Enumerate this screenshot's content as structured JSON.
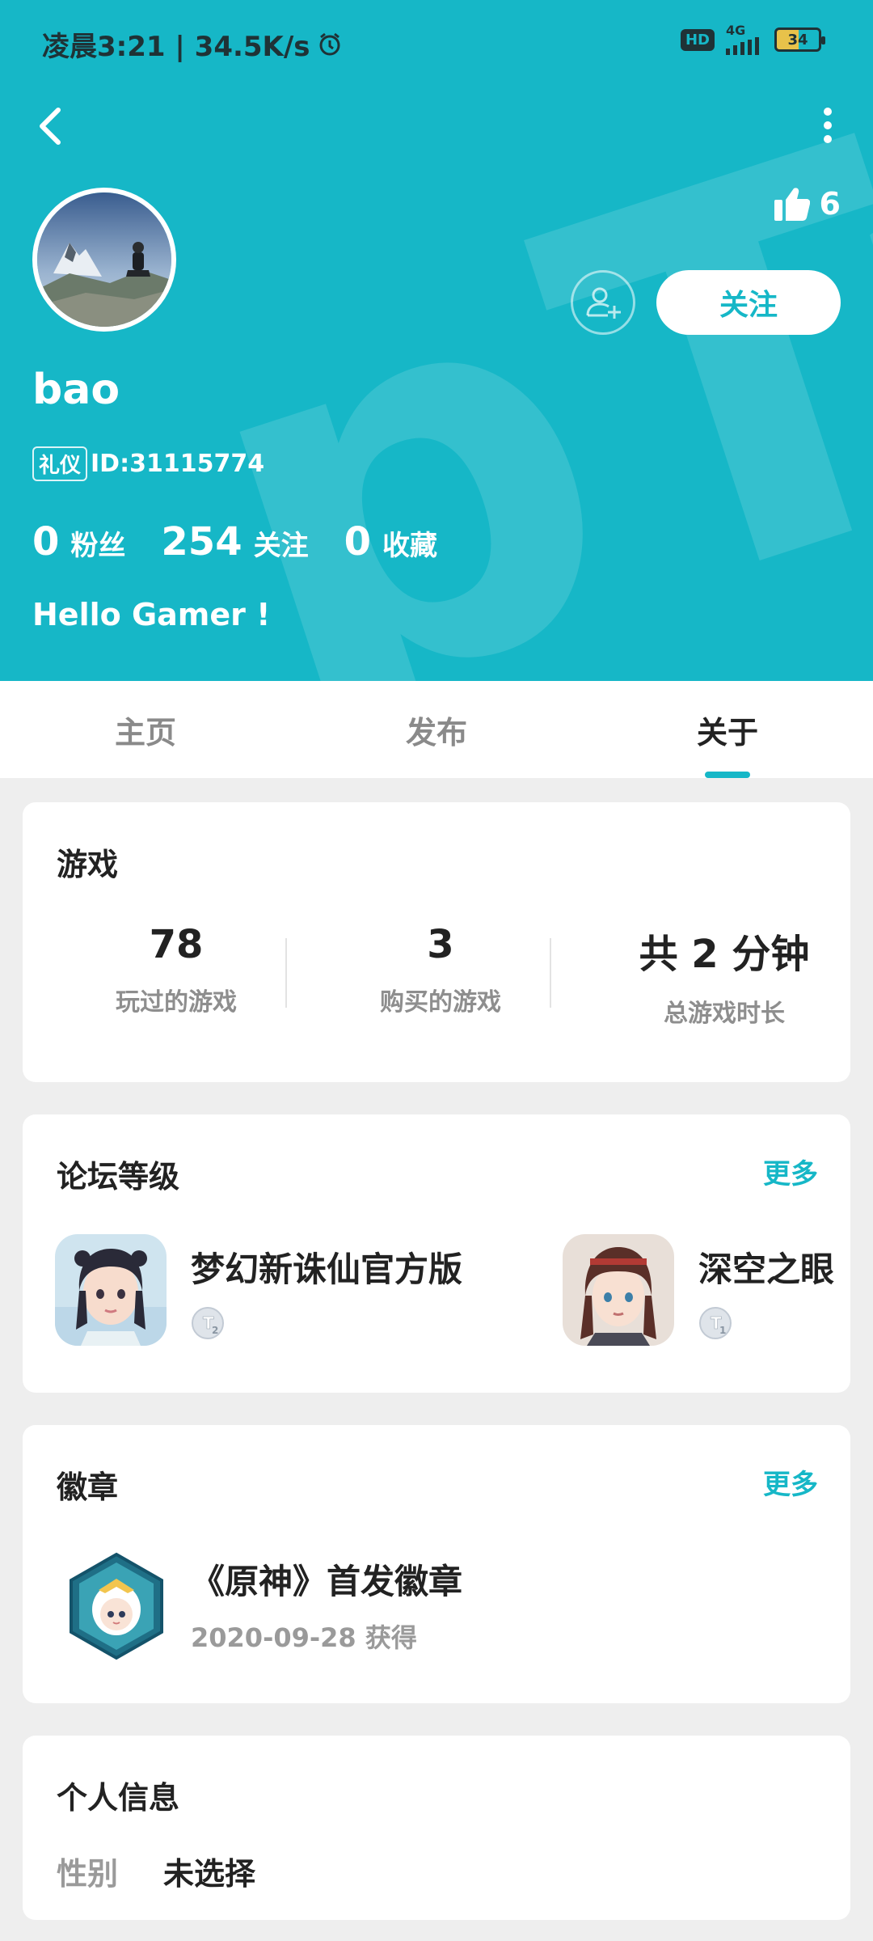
{
  "status_bar": {
    "time_speed": "凌晨3:21 | 34.5K/s",
    "network": "4G",
    "hd": "HD",
    "battery": "34"
  },
  "header": {
    "like_count": "6",
    "follow_label": "关注",
    "username": "bao",
    "title_badge": "礼仪",
    "user_id": "ID:31115774",
    "stats": [
      {
        "value": "0",
        "label": "粉丝"
      },
      {
        "value": "254",
        "label": "关注"
      },
      {
        "value": "0",
        "label": "收藏"
      }
    ],
    "bio": "Hello Gamer !",
    "accent_color": "#16b7c7"
  },
  "tabs": [
    {
      "label": "主页",
      "active": false
    },
    {
      "label": "发布",
      "active": false
    },
    {
      "label": "关于",
      "active": true
    }
  ],
  "games_card": {
    "title": "游戏",
    "stats": [
      {
        "value": "78",
        "label": "玩过的游戏"
      },
      {
        "value": "3",
        "label": "购买的游戏"
      },
      {
        "value": "共 2 分钟",
        "label": "总游戏时长"
      }
    ]
  },
  "forum_card": {
    "title": "论坛等级",
    "more": "更多",
    "items": [
      {
        "name": "梦幻新诛仙官方版",
        "level": "2"
      },
      {
        "name": "深空之眼",
        "level": "1"
      }
    ]
  },
  "badge_card": {
    "title": "徽章",
    "more": "更多",
    "medal_title": "《原神》首发徽章",
    "medal_date": "2020-09-28 获得"
  },
  "info_card": {
    "title": "个人信息",
    "gender_label": "性别",
    "gender_value": "未选择"
  }
}
